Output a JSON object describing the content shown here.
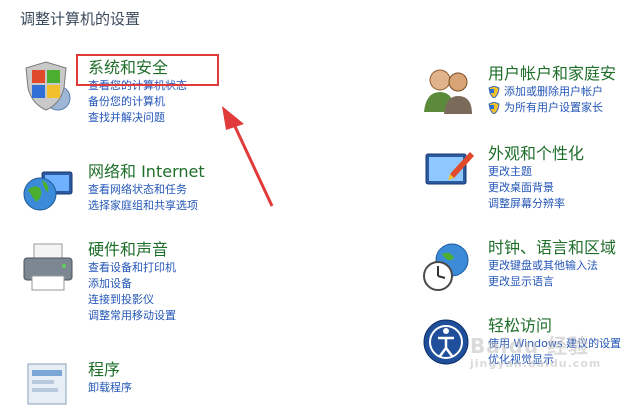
{
  "page_title": "调整计算机的设置",
  "left_categories": [
    {
      "title": "系统和安全",
      "icon": "shield-flag-icon",
      "links": [
        "查看您的计算机状态",
        "备份您的计算机",
        "查找并解决问题"
      ]
    },
    {
      "title": "网络和 Internet",
      "icon": "network-globe-icon",
      "links": [
        "查看网络状态和任务",
        "选择家庭组和共享选项"
      ]
    },
    {
      "title": "硬件和声音",
      "icon": "printer-icon",
      "links": [
        "查看设备和打印机",
        "添加设备",
        "连接到投影仪",
        "调整常用移动设置"
      ]
    },
    {
      "title": "程序",
      "icon": "programs-icon",
      "links": [
        "卸载程序"
      ]
    }
  ],
  "right_categories": [
    {
      "title": "用户帐户和家庭安",
      "icon": "users-icon",
      "links": [
        "添加或删除用户帐户",
        "为所有用户设置家长"
      ],
      "link_icons": true
    },
    {
      "title": "外观和个性化",
      "icon": "appearance-icon",
      "links": [
        "更改主题",
        "更改桌面背景",
        "调整屏幕分辨率"
      ]
    },
    {
      "title": "时钟、语言和区域",
      "icon": "clock-globe-icon",
      "links": [
        "更改键盘或其他输入法",
        "更改显示语言"
      ]
    },
    {
      "title": "轻松访问",
      "icon": "accessibility-icon",
      "links": [
        "使用 Windows 建议的设置",
        "优化视觉显示"
      ]
    }
  ],
  "watermark": {
    "main": "Baidu 经验",
    "sub": "jingyan.baidu.com"
  },
  "colors": {
    "heading": "#1e6e2a",
    "link": "#2456b8",
    "highlight": "#e03a3a",
    "title": "#3a4a5c"
  }
}
